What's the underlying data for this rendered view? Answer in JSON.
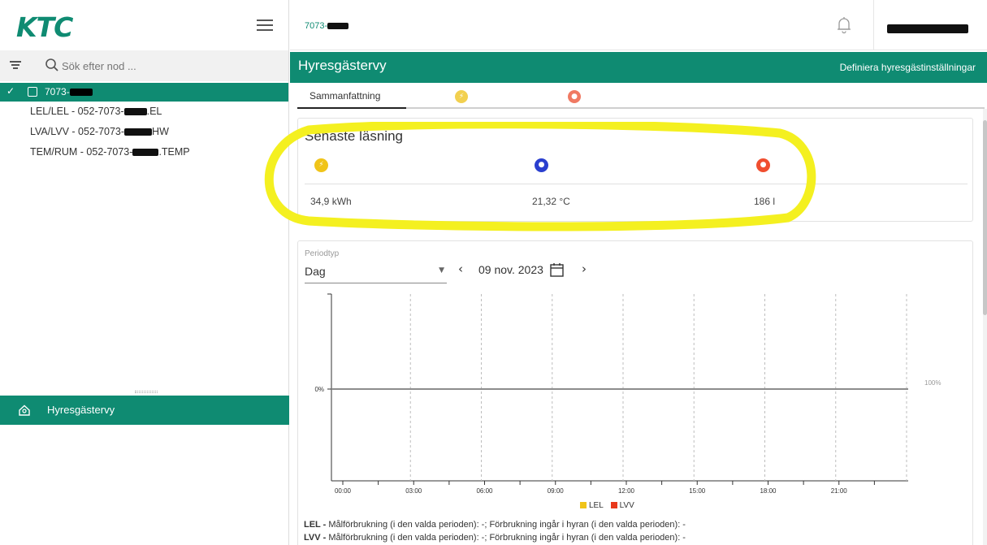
{
  "brand": {
    "logo_text": "KTC",
    "logo_color": "#0f8b72",
    "accent": "#0f8b72"
  },
  "sidebar": {
    "search_placeholder": "Sök efter nod ...",
    "tree": {
      "root_label": "7073-",
      "children": [
        {
          "prefix": "LEL/LEL - 052-7073-",
          "suffix": ".EL"
        },
        {
          "prefix": "LVA/LVV - 052-7073-",
          "suffix": "HW"
        },
        {
          "prefix": "TEM/RUM - 052-7073-",
          "suffix": ".TEMP"
        }
      ]
    },
    "nav_item": "Hyresgästervy"
  },
  "topbar": {
    "breadcrumb": "7073-"
  },
  "header": {
    "title": "Hyresgästervy",
    "define_link": "Definiera hyresgästinställningar"
  },
  "tabs": {
    "summary": "Sammanfattning",
    "electricity_icon": "lightning-icon",
    "water_icon": "drop-icon"
  },
  "latest": {
    "title": "Senaste läsning",
    "electricity": {
      "value": "34,9 kWh",
      "color": "#f0c419"
    },
    "temperature": {
      "value": "21,32 °C",
      "color": "#2a3fcf"
    },
    "water": {
      "value": "186 l",
      "color": "#f04e2f"
    }
  },
  "period": {
    "label": "Periodtyp",
    "type": "Dag",
    "date": "09 nov. 2023"
  },
  "chart_data": {
    "type": "line",
    "x": [
      "00:00",
      "03:00",
      "06:00",
      "09:00",
      "12:00",
      "15:00",
      "18:00",
      "21:00"
    ],
    "y_left_ticks": [
      "0%"
    ],
    "y_right_ticks": [
      "100%"
    ],
    "series": [
      {
        "name": "LEL",
        "color": "#f0c419",
        "values": []
      },
      {
        "name": "LVV",
        "color": "#e8391c",
        "values": []
      }
    ],
    "grid": "vertical-dashed"
  },
  "footnotes": [
    {
      "key": "LEL -",
      "text": " Målförbrukning (i den valda perioden): -; Förbrukning ingår i hyran (i den valda perioden): -"
    },
    {
      "key": "LVV -",
      "text": " Målförbrukning (i den valda perioden): -; Förbrukning ingår i hyran (i den valda perioden): -"
    }
  ]
}
